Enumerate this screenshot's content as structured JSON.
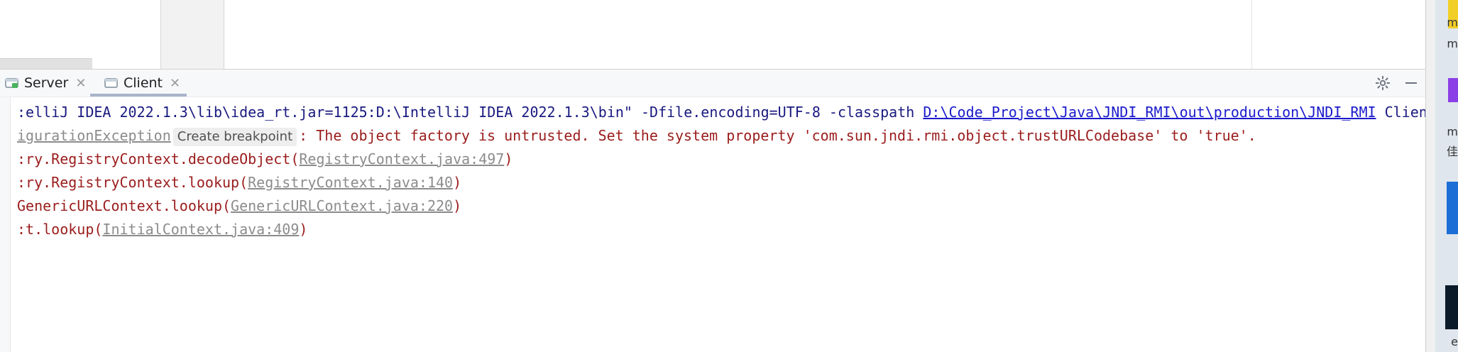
{
  "tool_window": {
    "tabs": [
      {
        "label": "Server",
        "icon": "run-config-icon",
        "active": false
      },
      {
        "label": "Client",
        "icon": "run-config-icon",
        "active": true
      }
    ]
  },
  "console": {
    "command": {
      "prefix": ":elliJ IDEA 2022.1.3\\lib\\idea_rt.jar=1125:D:\\IntelliJ IDEA 2022.1.3\\bin\" -Dfile.encoding=UTF-8 -classpath ",
      "classpath_link": "D:\\Code_Project\\Java\\JNDI_RMI\\out\\production\\JNDI_RMI",
      "suffix": " Client"
    },
    "error_line": {
      "exception": "igurationException",
      "breakpoint_label": "Create breakpoint",
      "message": ": The object factory is untrusted. Set the system property 'com.sun.jndi.rmi.object.trustURLCodebase' to 'true'."
    },
    "stack": [
      {
        "method": ":ry.RegistryContext.decodeObject(",
        "source": "RegistryContext.java:497",
        "close": ")"
      },
      {
        "method": ":ry.RegistryContext.lookup(",
        "source": "RegistryContext.java:140",
        "close": ")"
      },
      {
        "method": "GenericURLContext.lookup(",
        "source": "GenericURLContext.java:220",
        "close": ")"
      },
      {
        "method": ":t.lookup(",
        "source": "InitialContext.java:409",
        "close": ")"
      }
    ]
  },
  "right_window": {
    "text_1": "m",
    "text_2": "m",
    "text_3": "m",
    "text_4": "佳",
    "text_5": "e"
  },
  "colors": {
    "command_text": "#1a1a80",
    "error_text": "#9b1c1c",
    "link": "#1a1acc",
    "stack_link": "#8c8c8c"
  }
}
